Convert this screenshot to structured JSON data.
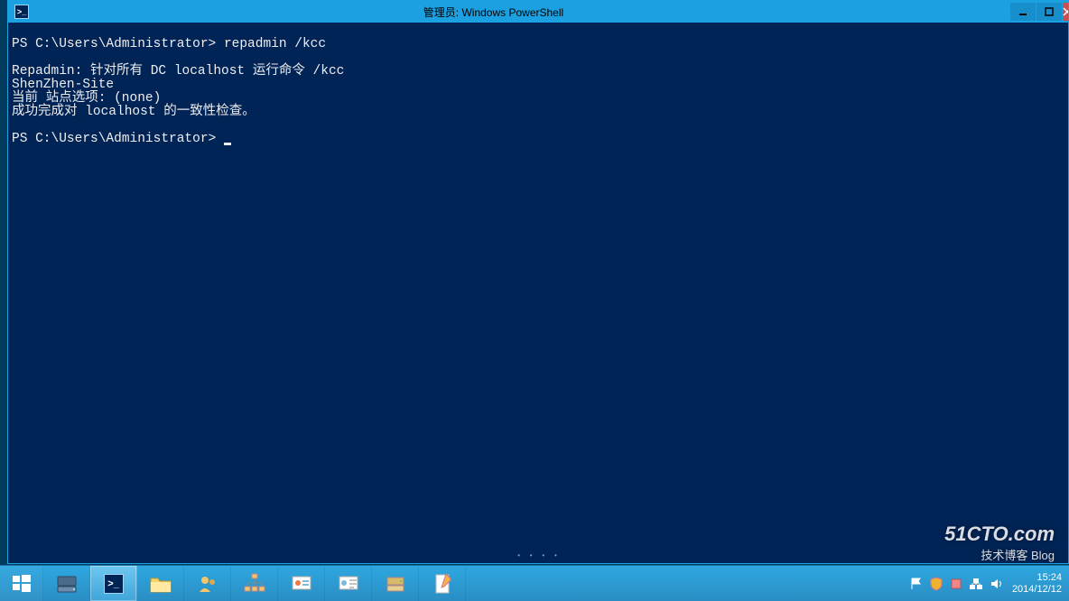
{
  "window": {
    "title": "管理员: Windows PowerShell",
    "minimize_label": "—",
    "maximize_label": "▢",
    "close_label": "✕"
  },
  "terminal": {
    "prompt1": "PS C:\\Users\\Administrator> ",
    "command1": "repadmin /kcc",
    "blank1": "",
    "output1": "Repadmin: 针对所有 DC localhost 运行命令 /kcc",
    "output2": "ShenZhen-Site",
    "output3": "当前 站点选项: (none)",
    "output4": "成功完成对 localhost 的一致性检查。",
    "blank2": "",
    "prompt2": "PS C:\\Users\\Administrator> "
  },
  "taskbar": {
    "items": [
      {
        "name": "start",
        "icon": "windows-icon"
      },
      {
        "name": "server-manager",
        "icon": "server-manager-icon"
      },
      {
        "name": "powershell",
        "icon": "powershell-icon",
        "active": true
      },
      {
        "name": "file-explorer",
        "icon": "explorer-icon"
      },
      {
        "name": "admin-tool-1",
        "icon": "people-icon"
      },
      {
        "name": "ad-sites",
        "icon": "network-tree-icon"
      },
      {
        "name": "snapin-1",
        "icon": "cert-icon"
      },
      {
        "name": "snapin-2",
        "icon": "console-icon"
      },
      {
        "name": "dns-manager",
        "icon": "dns-icon"
      },
      {
        "name": "document",
        "icon": "notes-icon"
      }
    ]
  },
  "tray": {
    "time": "15:24",
    "date": "2014/12/12"
  },
  "watermark": {
    "line1": "51CTO.com",
    "line2": "技术博客   Blog"
  }
}
